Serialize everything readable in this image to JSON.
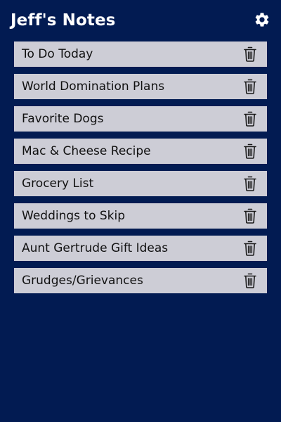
{
  "app": {
    "title": "Jeff's Notes",
    "settings_icon": "gear-icon",
    "delete_icon": "trash-icon",
    "colors": {
      "background": "#021b52",
      "note_background": "#cdcdd6",
      "text": "#111111",
      "header_text": "#ffffff"
    }
  },
  "notes": [
    {
      "label": "To Do Today"
    },
    {
      "label": "World Domination Plans"
    },
    {
      "label": "Favorite Dogs"
    },
    {
      "label": "Mac & Cheese Recipe"
    },
    {
      "label": "Grocery List"
    },
    {
      "label": "Weddings to Skip"
    },
    {
      "label": "Aunt Gertrude Gift Ideas"
    },
    {
      "label": "Grudges/Grievances"
    }
  ]
}
